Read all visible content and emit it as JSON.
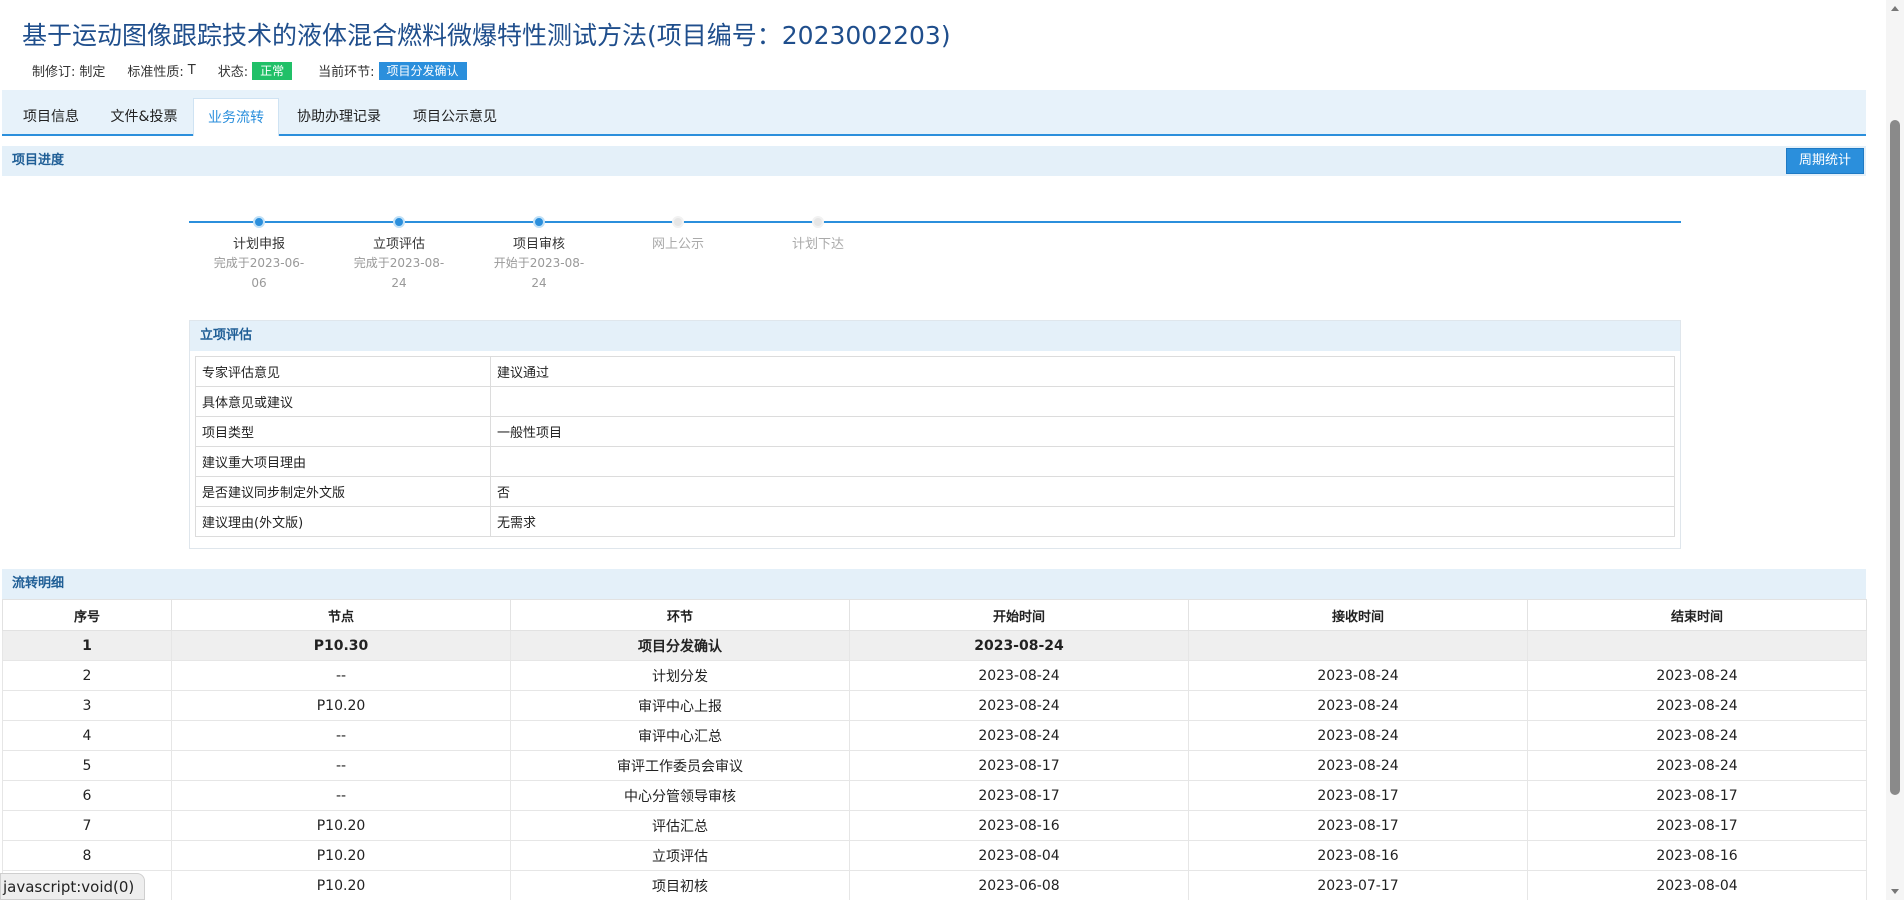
{
  "header": {
    "title": "基于运动图像跟踪技术的液体混合燃料微爆特性测试方法(项目编号：2023002203)",
    "revision_label": "制修订:",
    "revision_value": "制定",
    "nature_label": "标准性质:",
    "nature_value": "T",
    "status_label": "状态:",
    "status_value": "正常",
    "stage_label": "当前环节:",
    "stage_value": "项目分发确认"
  },
  "tabs": [
    {
      "label": "项目信息",
      "active": false
    },
    {
      "label": "文件&投票",
      "active": false
    },
    {
      "label": "业务流转",
      "active": true
    },
    {
      "label": "协助办理记录",
      "active": false
    },
    {
      "label": "项目公示意见",
      "active": false
    }
  ],
  "progress": {
    "section_title": "项目进度",
    "cycle_button": "周期统计",
    "steps": [
      {
        "name": "计划申报",
        "sub1": "完成于2023-06-",
        "sub2": "06",
        "state": "done"
      },
      {
        "name": "立项评估",
        "sub1": "完成于2023-08-",
        "sub2": "24",
        "state": "done"
      },
      {
        "name": "项目审核",
        "sub1": "开始于2023-08-",
        "sub2": "24",
        "state": "current"
      },
      {
        "name": "网上公示",
        "sub1": "",
        "sub2": "",
        "state": "pending"
      },
      {
        "name": "计划下达",
        "sub1": "",
        "sub2": "",
        "state": "pending"
      }
    ]
  },
  "evaluation": {
    "title": "立项评估",
    "rows": [
      {
        "key": "专家评估意见",
        "value": "建议通过"
      },
      {
        "key": "具体意见或建议",
        "value": ""
      },
      {
        "key": "项目类型",
        "value": "一般性项目"
      },
      {
        "key": "建议重大项目理由",
        "value": ""
      },
      {
        "key": "是否建议同步制定外文版",
        "value": "否"
      },
      {
        "key": "建议理由(外文版)",
        "value": "无需求"
      }
    ]
  },
  "flow": {
    "title": "流转明细",
    "columns": [
      "序号",
      "节点",
      "环节",
      "开始时间",
      "接收时间",
      "结束时间"
    ],
    "rows": [
      [
        "1",
        "P10.30",
        "项目分发确认",
        "2023-08-24",
        "",
        ""
      ],
      [
        "2",
        "--",
        "计划分发",
        "2023-08-24",
        "2023-08-24",
        "2023-08-24"
      ],
      [
        "3",
        "P10.20",
        "审评中心上报",
        "2023-08-24",
        "2023-08-24",
        "2023-08-24"
      ],
      [
        "4",
        "--",
        "审评中心汇总",
        "2023-08-24",
        "2023-08-24",
        "2023-08-24"
      ],
      [
        "5",
        "--",
        "审评工作委员会审议",
        "2023-08-17",
        "2023-08-24",
        "2023-08-24"
      ],
      [
        "6",
        "--",
        "中心分管领导审核",
        "2023-08-17",
        "2023-08-17",
        "2023-08-17"
      ],
      [
        "7",
        "P10.20",
        "评估汇总",
        "2023-08-16",
        "2023-08-17",
        "2023-08-17"
      ],
      [
        "8",
        "P10.20",
        "立项评估",
        "2023-08-04",
        "2023-08-16",
        "2023-08-16"
      ],
      [
        "",
        "P10.20",
        "项目初核",
        "2023-06-08",
        "2023-07-17",
        "2023-08-04"
      ]
    ]
  },
  "statusbar": {
    "text": "javascript:void(0)"
  },
  "colors": {
    "accent": "#2b8fdc",
    "status_green": "#21c068",
    "header_bg": "#e4f0f9"
  }
}
